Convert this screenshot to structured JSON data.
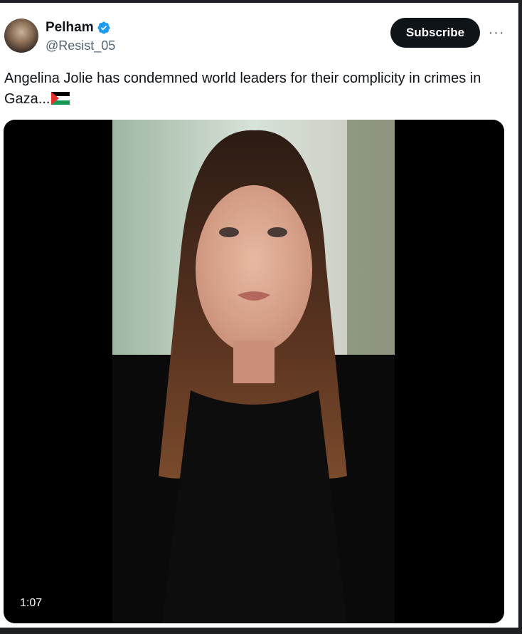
{
  "post": {
    "author_name": "Pelham",
    "author_handle": "@Resist_05",
    "verified_icon": "verified-badge-icon",
    "subscribe_label": "Subscribe",
    "more_label": "···",
    "text": "Angelina Jolie has condemned world leaders for their complicity in crimes in Gaza...",
    "text_emoji": "palestine-flag-icon"
  },
  "media": {
    "type": "video",
    "duration": "1:07"
  },
  "colors": {
    "verified": "#1d9bf0",
    "subscribe_bg": "#0f1419",
    "handle": "#536471"
  }
}
